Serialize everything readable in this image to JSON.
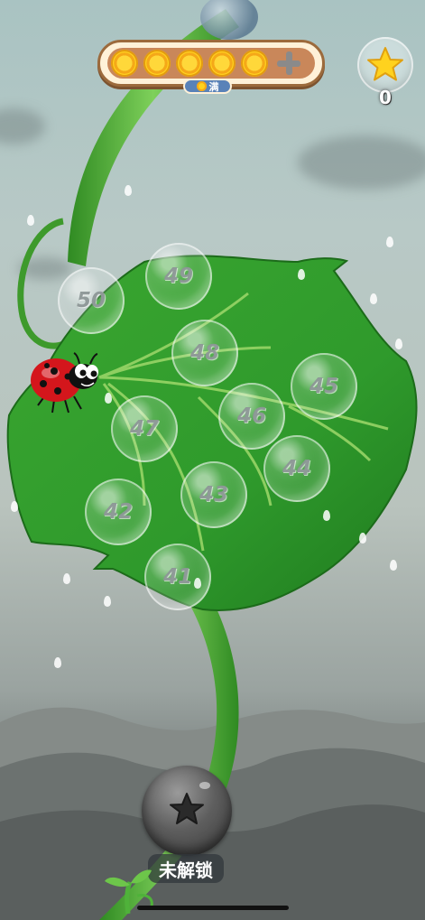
{
  "top_bar": {
    "suns": [
      "sun",
      "sun",
      "sun",
      "sun",
      "sun"
    ],
    "add_icon": "plus-icon",
    "badge_text": "满"
  },
  "stars": {
    "icon": "star-icon",
    "count": "0"
  },
  "levels": [
    {
      "number": "50"
    },
    {
      "number": "49"
    },
    {
      "number": "48"
    },
    {
      "number": "47"
    },
    {
      "number": "46"
    },
    {
      "number": "45"
    },
    {
      "number": "44"
    },
    {
      "number": "43"
    },
    {
      "number": "42"
    },
    {
      "number": "41"
    }
  ],
  "next_stage": {
    "icon": "star-icon",
    "label": "未解锁"
  },
  "colors": {
    "leaf": "#2f9a2c",
    "stem": "#4fb23a",
    "sun": "#ffd21e",
    "badge": "#5a82b8",
    "frame": "#9c6a3c"
  }
}
